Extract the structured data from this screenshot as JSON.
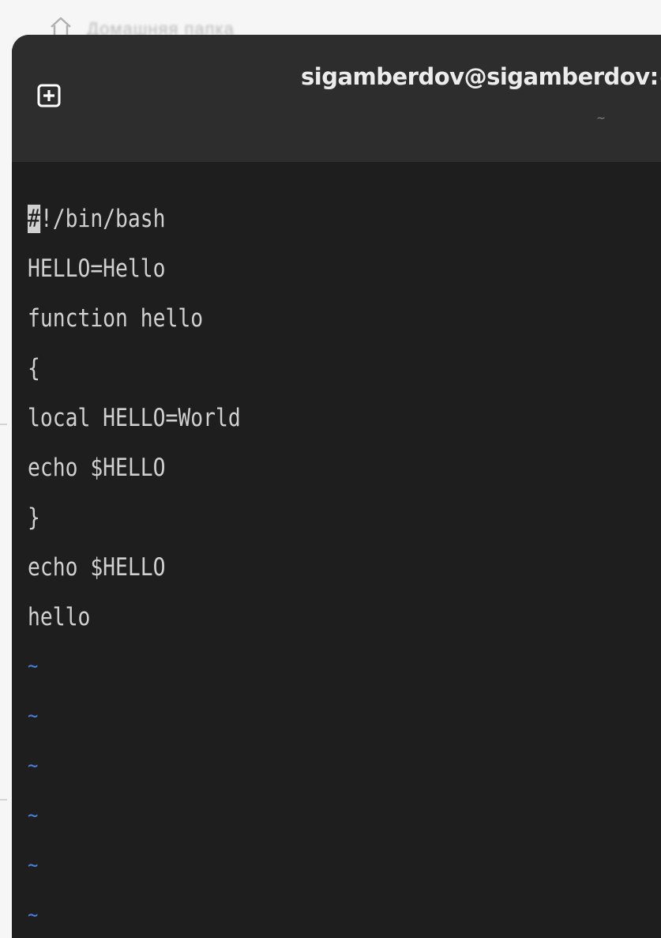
{
  "background": {
    "label": "Домашняя папка",
    "icon": "home-icon"
  },
  "terminal": {
    "title": "sigamberdov@sigamberdov:~ — /",
    "subtitle": "~",
    "new_tab_icon": "plus-square-icon",
    "colors": {
      "titlebar": "#2d2d2d",
      "editor_bg": "#1e1e1e",
      "text": "#d0d0d0",
      "tilde": "#4a7fd4"
    }
  },
  "editor": {
    "cursor_char": "#",
    "first_line_rest": "!/bin/bash",
    "lines": [
      "#!/bin/bash",
      "HELLO=Hello",
      "function hello",
      "{",
      "local HELLO=World",
      "echo $HELLO",
      "}",
      "echo $HELLO",
      "hello"
    ],
    "empty_line_marker": "~",
    "empty_line_count": 6
  }
}
